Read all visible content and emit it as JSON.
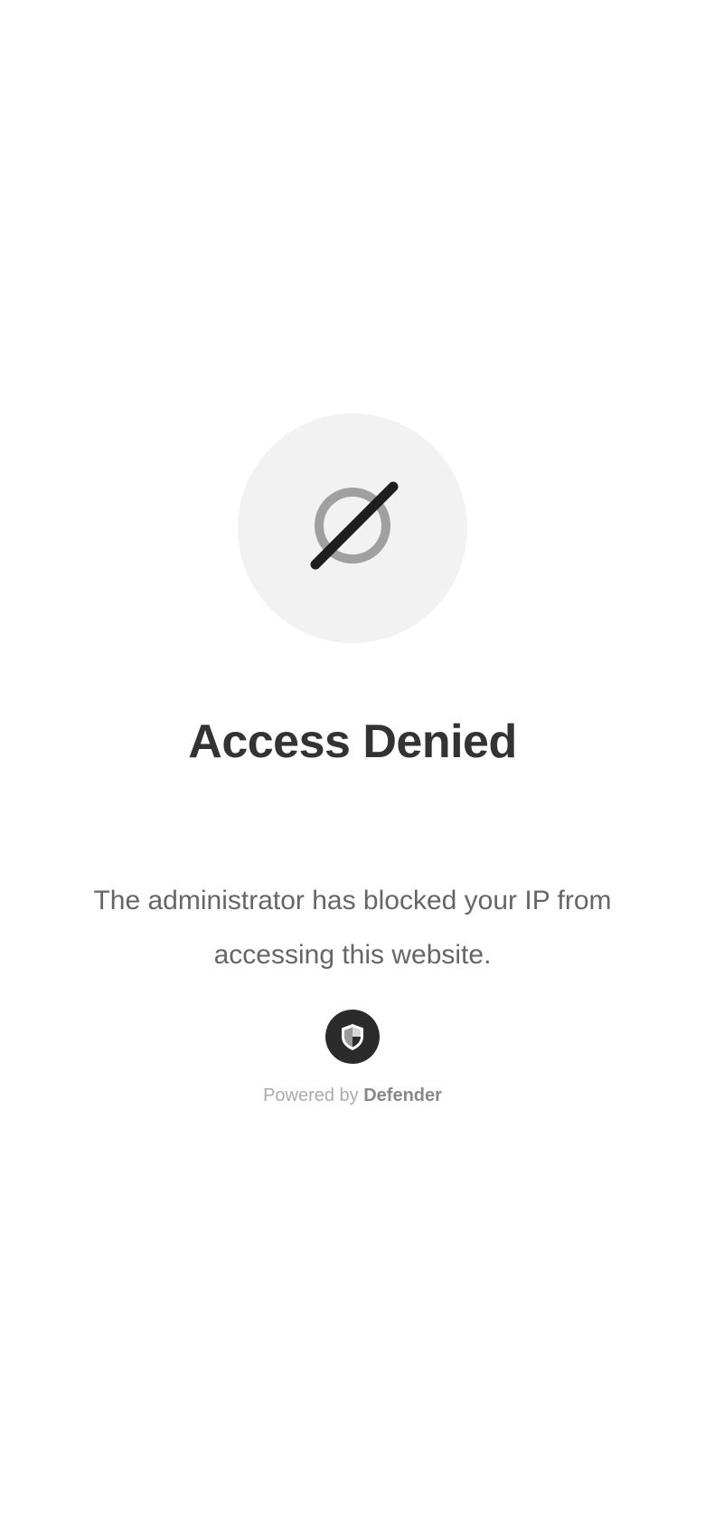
{
  "blocked": {
    "icon": "blocked-icon",
    "circle_color": "#f2f2f2",
    "ring_color": "#a0a0a0",
    "slash_color": "#1e1e1e"
  },
  "title": "Access Denied",
  "message": "The administrator has blocked your IP from accessing this website.",
  "footer": {
    "icon": "shield-icon",
    "powered_prefix": "Powered by ",
    "brand": "Defender"
  },
  "colors": {
    "title": "#333333",
    "message": "#666666",
    "badge": "#2b2b2b"
  }
}
